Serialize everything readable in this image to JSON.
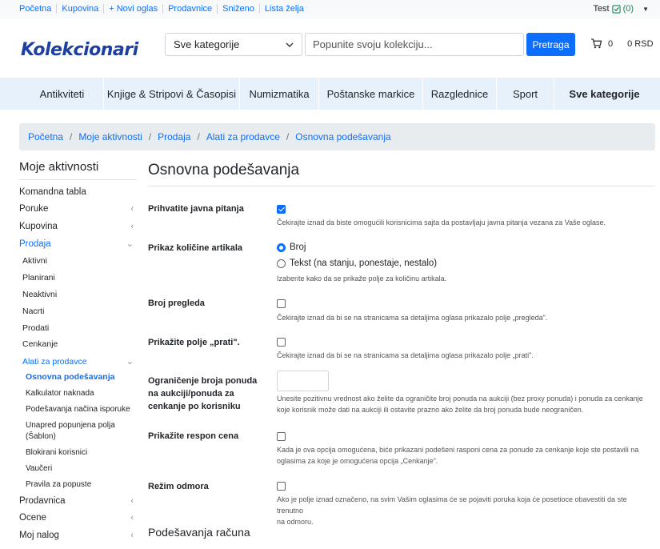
{
  "top_nav": [
    "Početna",
    "Kupovina",
    "+ Novi oglas",
    "Prodavnice",
    "Sniženo",
    "Lista želja"
  ],
  "user": {
    "name": "Test",
    "count": "(0)"
  },
  "logo_text": "Kolekcionari",
  "search": {
    "category_value": "Sve kategorije",
    "placeholder": "Popunite svoju kolekciju...",
    "button": "Pretraga"
  },
  "cart": {
    "count": "0",
    "amount": "0 RSD"
  },
  "categories": [
    "Antikviteti",
    "Knjige & Stripovi & Časopisi",
    "Numizmatika",
    "Poštanske markice",
    "Razglednice",
    "Sport",
    "Sve kategorije"
  ],
  "breadcrumb": [
    "Početna",
    "Moje aktivnosti",
    "Prodaja",
    "Alati za prodavce",
    "Osnovna podešavanja"
  ],
  "sidebar": {
    "title": "Moje aktivnosti",
    "dashboard": "Komandna tabla",
    "poruke": "Poruke",
    "kupovina": "Kupovina",
    "prodaja": "Prodaja",
    "prodaja_items": [
      "Aktivni",
      "Planirani",
      "Neaktivni",
      "Nacrti",
      "Prodati",
      "Cenkanje"
    ],
    "alati": "Alati za prodavce",
    "alati_items": [
      "Osnovna podešavanja",
      "Kalkulator naknada",
      "Podešavanja načina isporuke",
      "Unapred popunjena polja",
      "(Šablon)",
      "Blokirani korisnici",
      "Vaučeri",
      "Pravila za popuste"
    ],
    "prodavnica": "Prodavnica",
    "ocene": "Ocene",
    "moj_nalog": "Moj nalog"
  },
  "page_title": "Osnovna podešavanja",
  "settings": {
    "questions": {
      "label": "Prihvatite javna pitanja",
      "checked": true,
      "help": "Čekirajte iznad da biste omogućili korisnicima sajta da postavljaju javna pitanja vezana za Vaše oglase."
    },
    "quantity": {
      "label": "Prikaz količine artikala",
      "opt1": "Broj",
      "opt2": "Tekst (na stanju, ponestaje, nestalo)",
      "selected": "Broj",
      "help": "Izaberite kako da se prikaže polje za količinu artikala."
    },
    "views": {
      "label": "Broj pregleda",
      "checked": false,
      "help": "Čekirajte iznad da bi se na stranicama sa detaljima oglasa prikazalo polje „pregleda\"."
    },
    "follow": {
      "label": "Prikažite polje „prati\".",
      "checked": false,
      "help": "Čekirajte iznad da bi se na stranicama sa detaljima oglasa prikazalo polje „prati\"."
    },
    "limit": {
      "label_1": "Ograničenje broja ponuda",
      "label_2": "na aukciji/ponuda za",
      "label_3": "cenkanje po korisniku",
      "value": "",
      "help_1": "Unesite pozitivnu vrednost ako želite da ograničite broj ponuda na aukciji (bez proxy ponuda) i ponuda za cenkanje",
      "help_2": "koje korisnik može dati na aukciji ili ostavite prazno ako želite da broj ponuda bude neograničen."
    },
    "range": {
      "label": "Prikažite respon cena",
      "checked": false,
      "help_1": "Kada je ova opcija omogućena, biće prikazani podešeni rasponi cena za ponude za cenkanje koje ste postavili na",
      "help_2": "oglasima za koje je omogućena opcija „Cenkanje\"."
    },
    "vacation": {
      "label": "Režim odmora",
      "checked": false,
      "help_1": "Ako je polje iznad označeno, na svim Vašim oglasima će se pojaviti poruka koja će posetioce obavestiti da ste trenutno",
      "help_2": "na odmoru."
    }
  },
  "section_account": "Podešavanja računa",
  "colors": {
    "primary": "#0d6efd",
    "catnav_bg": "#e7f1fb",
    "breadcrumb_bg": "#e9ecef"
  }
}
